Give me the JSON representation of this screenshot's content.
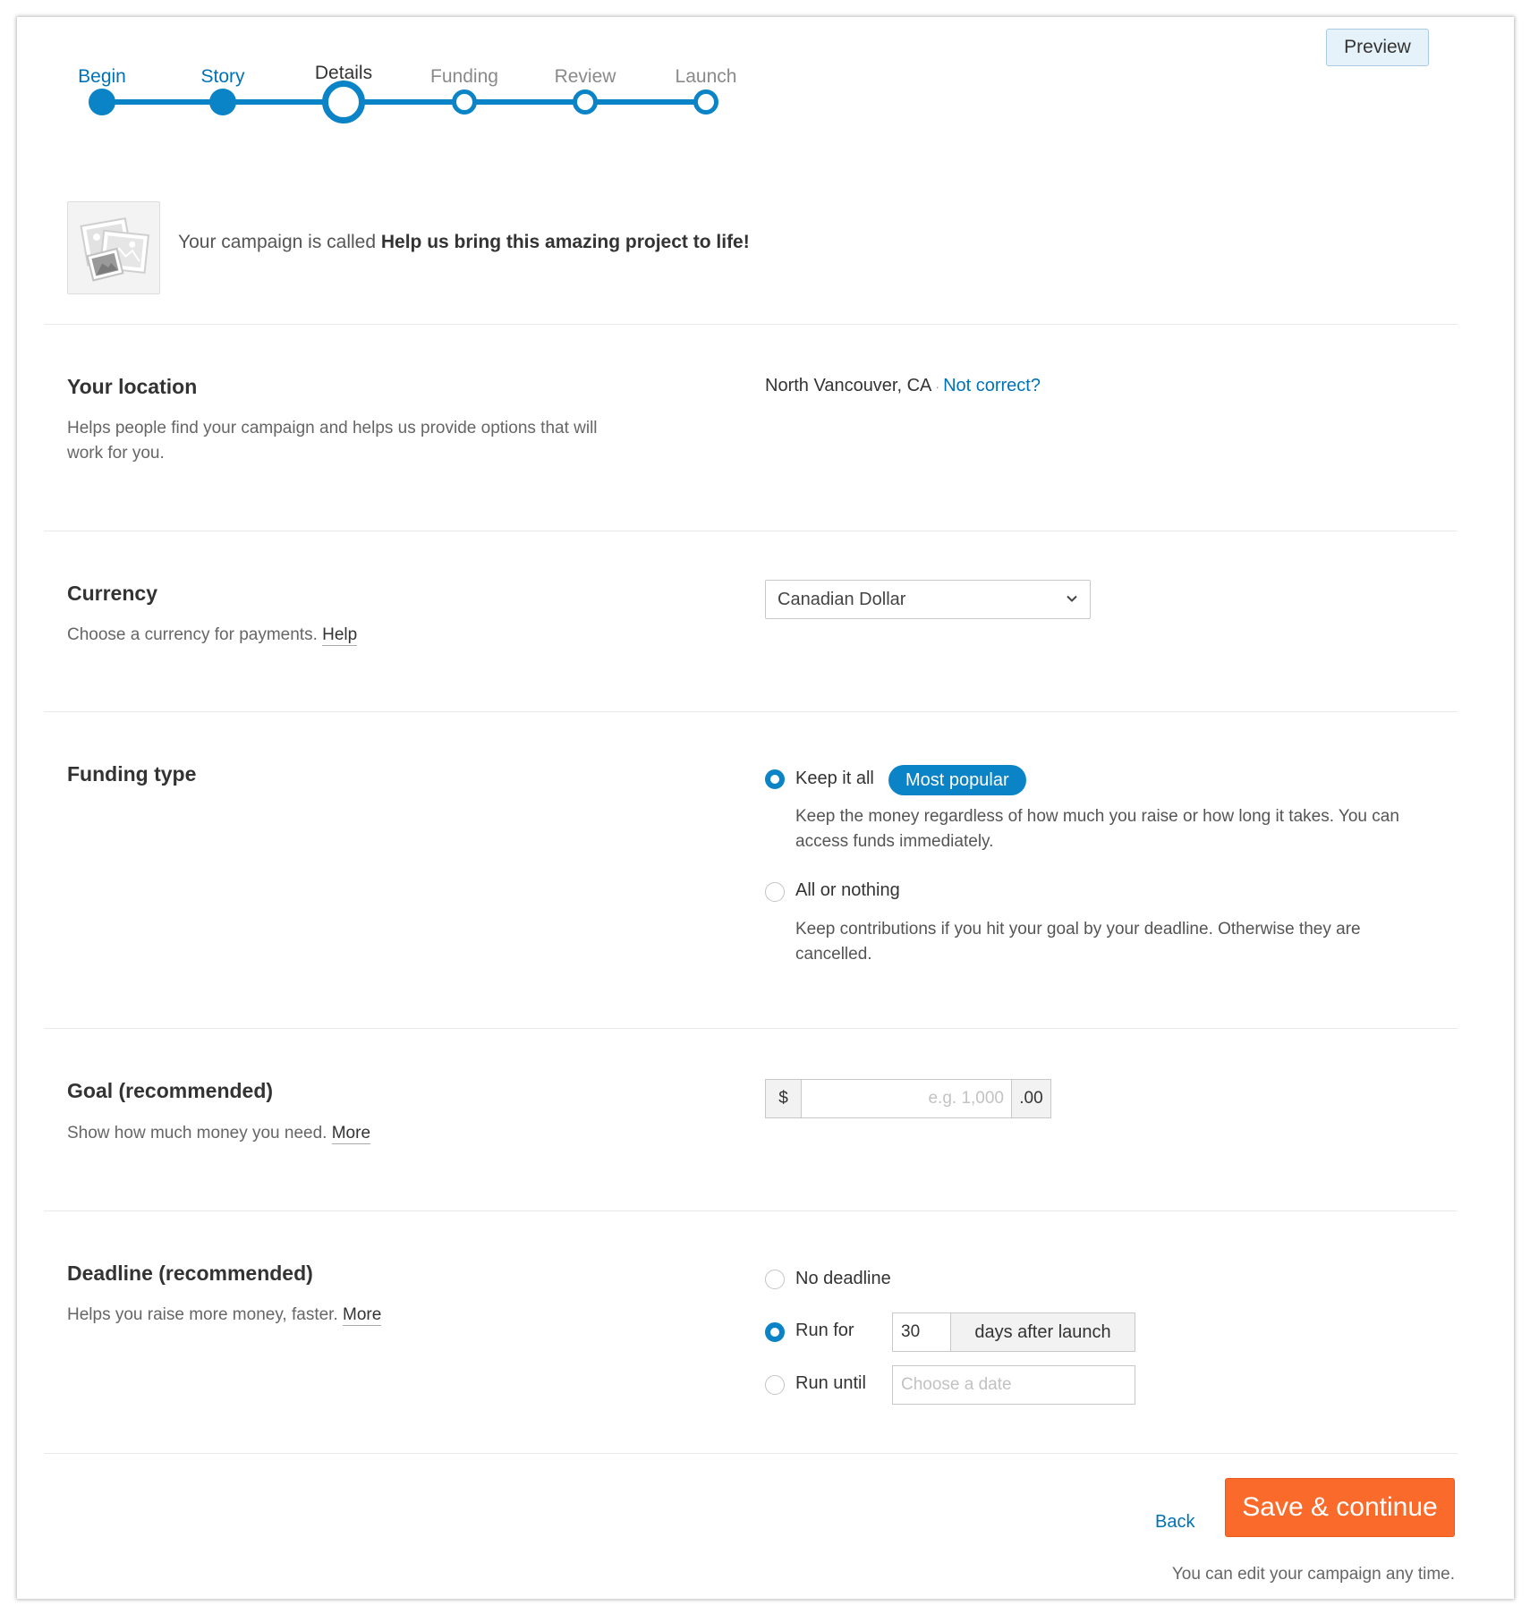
{
  "stepper": {
    "steps": [
      {
        "label": "Begin",
        "state": "done"
      },
      {
        "label": "Story",
        "state": "done"
      },
      {
        "label": "Details",
        "state": "current"
      },
      {
        "label": "Funding",
        "state": "future"
      },
      {
        "label": "Review",
        "state": "future"
      },
      {
        "label": "Launch",
        "state": "future"
      }
    ],
    "accent_color": "#0a84c6"
  },
  "header": {
    "preview_label": "Preview"
  },
  "campaign": {
    "prefix": "Your campaign is called ",
    "name": "Help us bring this amazing project to life!",
    "thumbnail_icon": "image-placeholder-icon"
  },
  "location": {
    "title": "Your location",
    "description": "Helps people find your campaign and helps us provide options that will work for you.",
    "value": "North Vancouver, CA",
    "separator": "·",
    "change_link": "Not correct?"
  },
  "currency": {
    "title": "Currency",
    "description": "Choose a currency for payments.",
    "help_link": "Help",
    "selected": "Canadian Dollar"
  },
  "funding_type": {
    "title": "Funding type",
    "options": [
      {
        "label": "Keep it all",
        "badge": "Most popular",
        "selected": true,
        "description": "Keep the money regardless of how much you raise or how long it takes. You can access funds immediately."
      },
      {
        "label": "All or nothing",
        "selected": false,
        "description": "Keep contributions if you hit your goal by your deadline. Otherwise they are cancelled."
      }
    ]
  },
  "goal": {
    "title": "Goal (recommended)",
    "description": "Show how much money you need.",
    "more_link": "More",
    "prefix": "$",
    "placeholder": "e.g. 1,000",
    "suffix": ".00"
  },
  "deadline": {
    "title": "Deadline (recommended)",
    "description": "Helps you raise more money, faster.",
    "more_link": "More",
    "options": [
      {
        "label": "No deadline",
        "selected": false
      },
      {
        "label": "Run for",
        "selected": true
      },
      {
        "label": "Run until",
        "selected": false
      }
    ],
    "days_value": "30",
    "days_suffix": "days after launch",
    "date_placeholder": "Choose a date"
  },
  "footer": {
    "back_label": "Back",
    "save_label": "Save & continue",
    "note": "You can edit your campaign any time.",
    "save_color": "#fa6b2b"
  }
}
